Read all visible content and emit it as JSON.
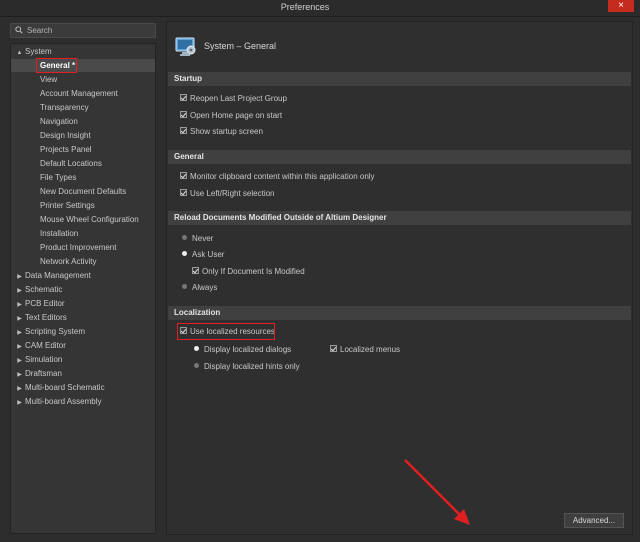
{
  "window": {
    "title": "Preferences",
    "close_label": "×"
  },
  "search": {
    "placeholder": "Search"
  },
  "tree": {
    "system": "System",
    "system_children": [
      "General *",
      "View",
      "Account Management",
      "Transparency",
      "Navigation",
      "Design Insight",
      "Projects Panel",
      "Default Locations",
      "File Types",
      "New Document Defaults",
      "Printer Settings",
      "Mouse Wheel Configuration",
      "Installation",
      "Product Improvement",
      "Network Activity"
    ],
    "top_items": [
      "Data Management",
      "Schematic",
      "PCB Editor",
      "Text Editors",
      "Scripting System",
      "CAM Editor",
      "Simulation",
      "Draftsman",
      "Multi-board Schematic",
      "Multi-board Assembly"
    ]
  },
  "page": {
    "title": "System – General"
  },
  "startup": {
    "header": "Startup",
    "reopen": "Reopen Last Project Group",
    "open_home": "Open Home page on start",
    "show_splash": "Show startup screen"
  },
  "general": {
    "header": "General",
    "monitor_clipboard": "Monitor clipboard content within this application only",
    "left_right": "Use Left/Right selection"
  },
  "reload": {
    "header": "Reload Documents Modified Outside of Altium Designer",
    "never": "Never",
    "ask_user": "Ask User",
    "only_if_modified": "Only If Document Is Modified",
    "always": "Always"
  },
  "localization": {
    "header": "Localization",
    "use_localized": "Use localized resources",
    "display_dialogs": "Display localized dialogs",
    "localized_menus": "Localized menus",
    "display_hints": "Display localized hints only"
  },
  "footer": {
    "advanced_label": "Advanced..."
  },
  "colors": {
    "annotation": "#e02020",
    "selection": "#4a4a4a"
  }
}
